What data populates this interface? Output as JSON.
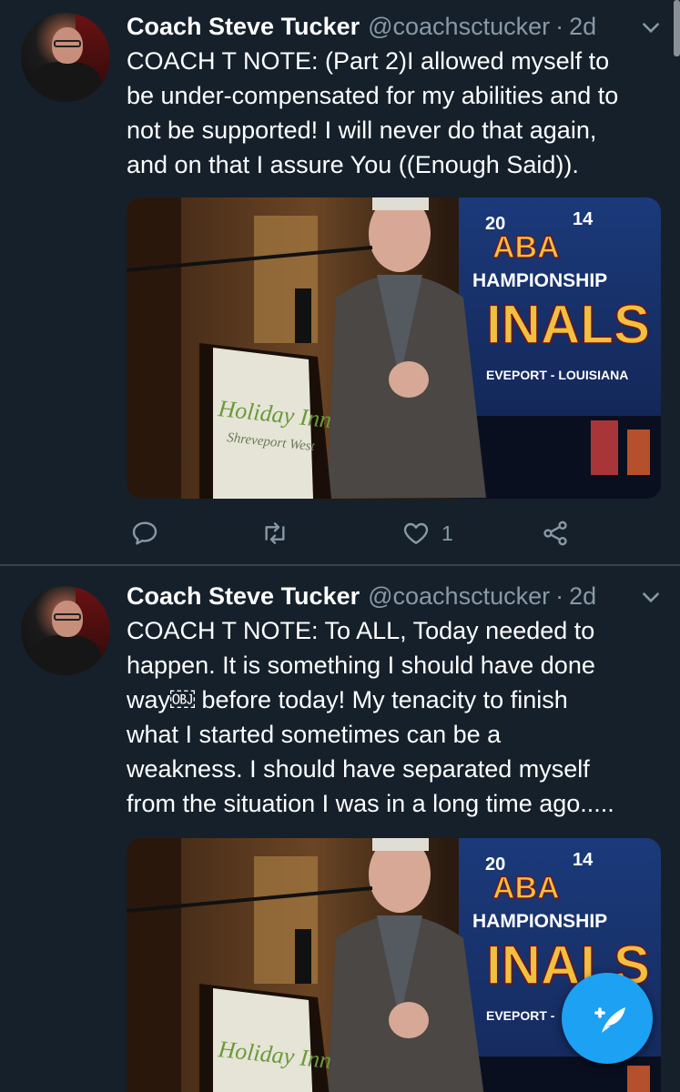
{
  "tweets": [
    {
      "author_name": "Coach Steve Tucker",
      "handle": "@coachsctucker",
      "separator": "·",
      "time": "2d",
      "text_lines": [
        "COACH T NOTE: (Part 2)I allowed myself to",
        "be under-compensated for my abilities and to",
        "not be supported! I will never do that again,",
        "and on that I assure You ((Enough Said))."
      ],
      "media": {
        "banner_year_left": "20",
        "banner_year_right": "14",
        "banner_logo": "ABA",
        "banner_line1": "HAMPIONSHIP",
        "banner_line2": "INALS",
        "banner_line3": "EVEPORT - LOUISIANA",
        "podium_line1": "Holiday Inn",
        "podium_line2": "Shreveport West"
      },
      "actions": {
        "reply_icon": "reply-icon",
        "retweet_icon": "retweet-icon",
        "like_icon": "heart-icon",
        "like_count": "1",
        "share_icon": "share-icon"
      }
    },
    {
      "author_name": "Coach Steve Tucker",
      "handle": "@coachsctucker",
      "separator": "·",
      "time": "2d",
      "text_lines": [
        "COACH T NOTE: To ALL, Today needed to",
        "happen. It is something I should have done",
        "way￼ before today! My tenacity to finish",
        "what I started sometimes can be a",
        "weakness. I should have separated myself",
        "from the situation I was in a long time ago....."
      ],
      "media": {
        "banner_year_left": "20",
        "banner_year_right": "14",
        "banner_logo": "ABA",
        "banner_line1": "HAMPIONSHIP",
        "banner_line2": "INALS",
        "banner_line3": "EVEPORT -",
        "podium_line1": "Holiday Inn"
      }
    }
  ],
  "compose_button": {
    "icon": "compose-feather-icon",
    "color": "#1da1f2"
  },
  "theme": {
    "background": "#15202b",
    "muted_text": "#8899a6",
    "divider": "#38444d"
  }
}
